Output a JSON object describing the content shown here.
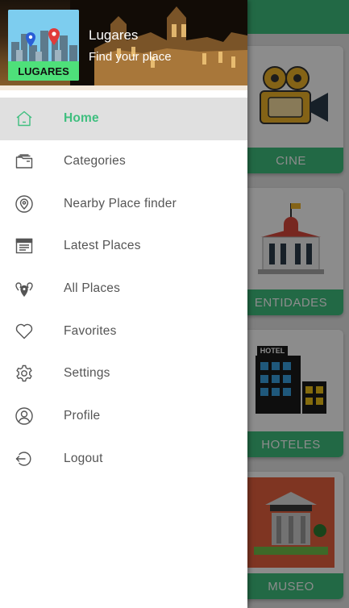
{
  "header": {
    "logo_text": "LUGARES",
    "app_name": "Lugares",
    "tagline": "Find your place"
  },
  "menu": {
    "items": [
      {
        "label": "Home",
        "icon": "home-icon",
        "active": true
      },
      {
        "label": "Categories",
        "icon": "folders-icon",
        "active": false
      },
      {
        "label": "Nearby Place finder",
        "icon": "location-pin-icon",
        "active": false
      },
      {
        "label": "Latest Places",
        "icon": "calendar-icon",
        "active": false
      },
      {
        "label": "All Places",
        "icon": "multi-pin-icon",
        "active": false
      },
      {
        "label": "Favorites",
        "icon": "heart-icon",
        "active": false
      },
      {
        "label": "Settings",
        "icon": "gear-icon",
        "active": false
      },
      {
        "label": "Profile",
        "icon": "user-circle-icon",
        "active": false
      },
      {
        "label": "Logout",
        "icon": "logout-icon",
        "active": false
      }
    ]
  },
  "background_cards": [
    {
      "label": "CINE",
      "icon": "movie-camera-icon"
    },
    {
      "label": "ENTIDADES",
      "icon": "government-building-icon"
    },
    {
      "label": "HOTELES",
      "icon": "hotel-building-icon"
    },
    {
      "label": "MUSEO",
      "icon": "museum-icon"
    }
  ],
  "colors": {
    "accent": "#3fbf7f",
    "menu_text": "#555555",
    "active_bg": "#e0e0e0",
    "icon_stroke": "#555555"
  }
}
